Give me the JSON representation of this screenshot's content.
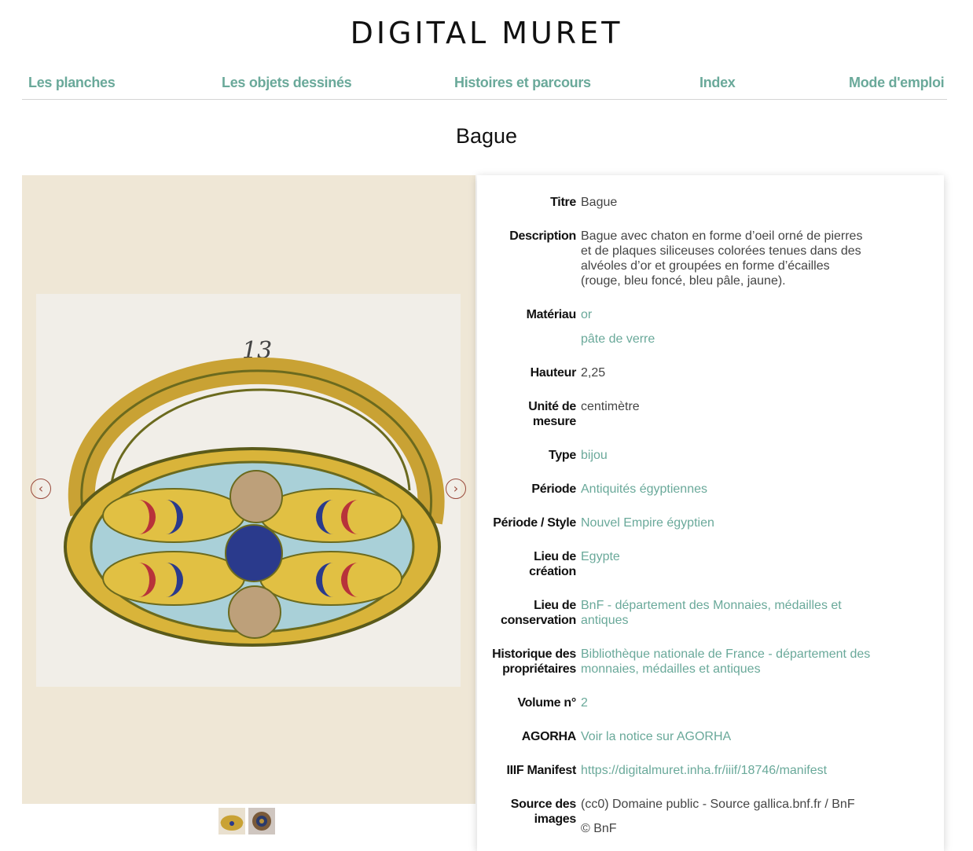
{
  "site": {
    "title": "DIGITAL MURET"
  },
  "nav": {
    "items": [
      "Les planches",
      "Les objets dessinés",
      "Histoires et parcours",
      "Index",
      "Mode d'emploi"
    ]
  },
  "page": {
    "title": "Bague"
  },
  "viewer": {
    "drawing_number": "13",
    "prev_icon": "chevron-left-icon",
    "next_icon": "chevron-right-icon",
    "prev_glyph": "‹",
    "next_glyph": "›",
    "colors": {
      "gold": "#d9b43a",
      "red": "#b8323a",
      "blue": "#2a3a8c",
      "pale_blue": "#a9d0d8",
      "tan": "#bda07a"
    }
  },
  "thumbnails": [
    {
      "name": "thumbnail-1"
    },
    {
      "name": "thumbnail-2"
    }
  ],
  "metadata": {
    "titre": {
      "label": "Titre",
      "value": "Bague"
    },
    "description": {
      "label": "Description",
      "value": "Bague avec chaton en forme d’oeil orné de pierres et de plaques siliceuses colorées tenues dans des alvéoles d’or et groupées en forme d’écailles (rouge, bleu foncé, bleu pâle, jaune)."
    },
    "materiau": {
      "label": "Matériau",
      "values": [
        "or",
        "pâte de verre"
      ]
    },
    "hauteur": {
      "label": "Hauteur",
      "value": "2,25"
    },
    "unite": {
      "label": "Unité de mesure",
      "value": "centimètre"
    },
    "type": {
      "label": "Type",
      "value": "bijou"
    },
    "periode": {
      "label": "Période",
      "value": "Antiquités égyptiennes"
    },
    "periode_style": {
      "label": "Période / Style",
      "value": "Nouvel Empire égyptien"
    },
    "lieu_creation": {
      "label": "Lieu de création",
      "value": "Egypte"
    },
    "lieu_conservation": {
      "label": "Lieu de conservation",
      "value": "BnF - département des Monnaies, médailles et antiques"
    },
    "historique": {
      "label": "Historique des propriétaires",
      "value": "Bibliothèque nationale de France - département des monnaies, médailles et antiques"
    },
    "volume": {
      "label": "Volume n°",
      "value": "2"
    },
    "agorha": {
      "label": "AGORHA",
      "value": "Voir la notice sur AGORHA"
    },
    "iiif": {
      "label": "IIIF Manifest",
      "value": "https://digitalmuret.inha.fr/iiif/18746/manifest"
    },
    "source": {
      "label": "Source des images",
      "values": [
        "(cc0) Domaine public - Source gallica.bnf.fr / BnF",
        "© BnF"
      ]
    }
  }
}
